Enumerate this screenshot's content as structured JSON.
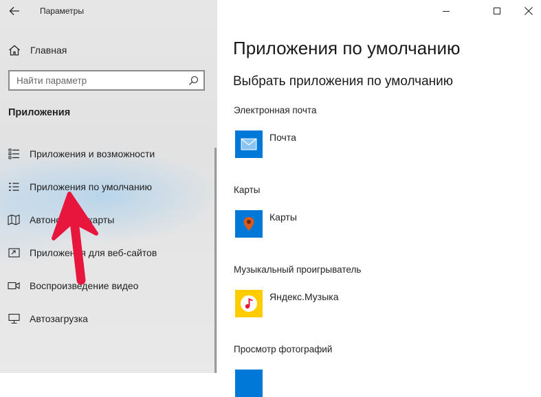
{
  "window": {
    "title": "Параметры"
  },
  "sidebar": {
    "home_label": "Главная",
    "search_placeholder": "Найти параметр",
    "section_title": "Приложения",
    "items": [
      {
        "label": "Приложения и возможности",
        "icon": "apps-features-icon"
      },
      {
        "label": "Приложения по умолчанию",
        "icon": "default-apps-icon"
      },
      {
        "label": "Автономные карты",
        "icon": "offline-maps-icon"
      },
      {
        "label": "Приложения для веб-сайтов",
        "icon": "apps-for-websites-icon"
      },
      {
        "label": "Воспроизведение видео",
        "icon": "video-playback-icon"
      },
      {
        "label": "Автозагрузка",
        "icon": "startup-icon"
      }
    ]
  },
  "main": {
    "title": "Приложения по умолчанию",
    "subtitle": "Выбрать приложения по умолчанию",
    "categories": [
      {
        "label": "Электронная почта",
        "app": "Почта",
        "icon": "mail-app-icon"
      },
      {
        "label": "Карты",
        "app": "Карты",
        "icon": "maps-app-icon"
      },
      {
        "label": "Музыкальный проигрыватель",
        "app": "Яндекс.Музыка",
        "icon": "yandex-music-icon"
      },
      {
        "label": "Просмотр фотографий",
        "app": "",
        "icon": "photos-app-icon"
      }
    ]
  },
  "colors": {
    "accent": "#0078d7",
    "arrow": "#e8163c",
    "sidebar_bg": "#e6e6e6",
    "music_yellow": "#ffcc00"
  }
}
